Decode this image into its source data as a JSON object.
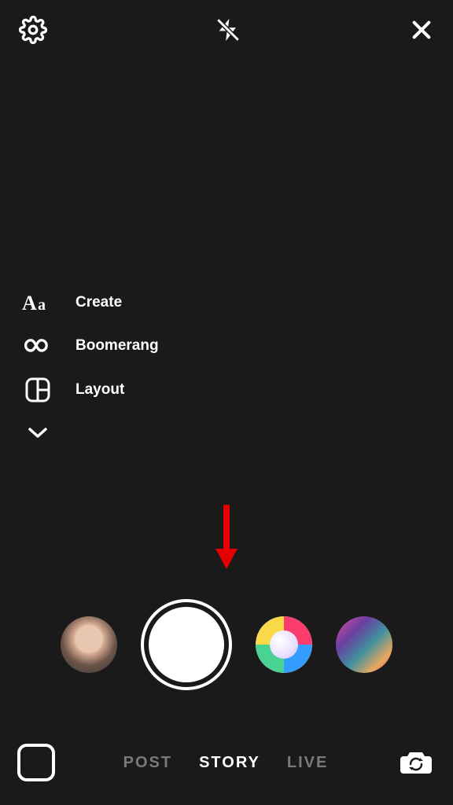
{
  "sideTools": {
    "create": "Create",
    "boomerang": "Boomerang",
    "layout": "Layout"
  },
  "modes": {
    "post": "POST",
    "story": "STORY",
    "live": "LIVE"
  }
}
